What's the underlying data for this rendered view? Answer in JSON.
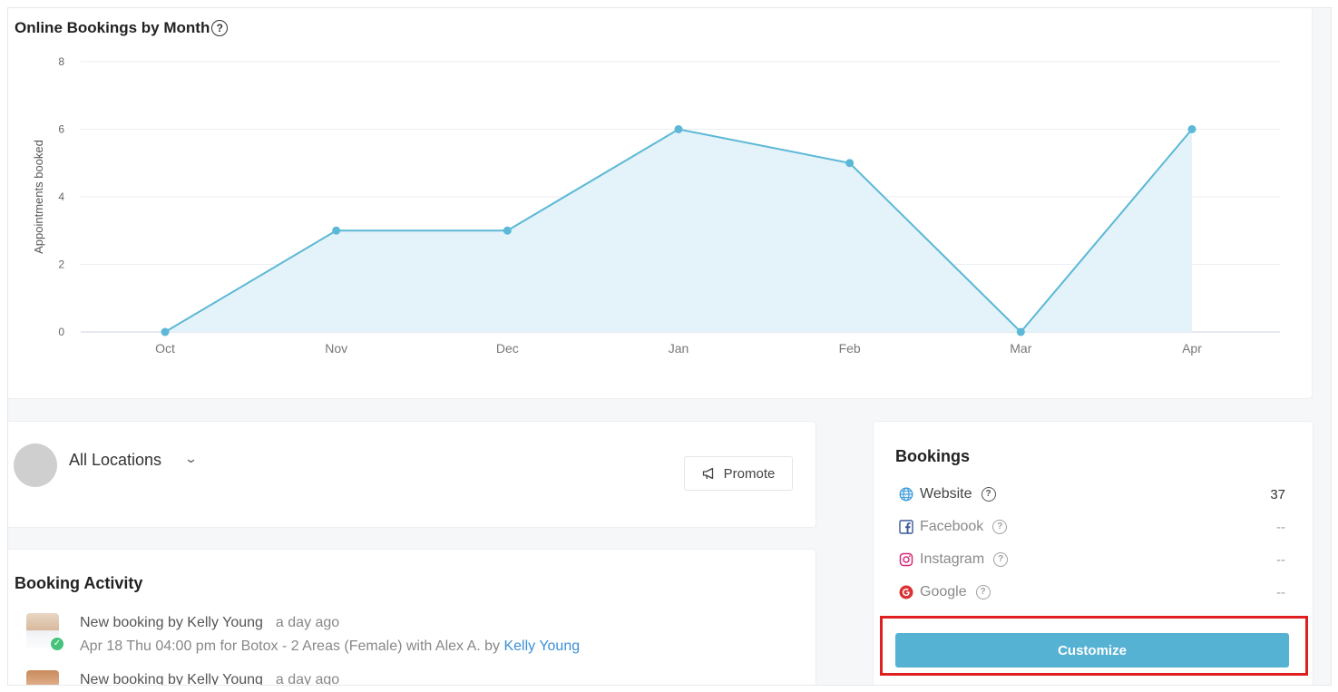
{
  "chart": {
    "title": "Online Bookings by Month",
    "help_icon": "question-circle-icon"
  },
  "chart_data": {
    "type": "area",
    "title": "Online Bookings by Month",
    "xlabel": "",
    "ylabel": "Appointments booked",
    "categories": [
      "Oct",
      "Nov",
      "Dec",
      "Jan",
      "Feb",
      "Mar",
      "Apr"
    ],
    "values": [
      0,
      3,
      3,
      6,
      5,
      0,
      6
    ],
    "ylim": [
      0,
      8
    ],
    "yticks": [
      0,
      2,
      4,
      6,
      8
    ],
    "grid": true,
    "line_color": "#5bb8d6",
    "fill_color": "#e4f2f9"
  },
  "location": {
    "label": "All Locations",
    "chevron_icon": "chevron-down-icon",
    "promote_label": "Promote",
    "promote_icon": "megaphone-icon"
  },
  "activity": {
    "title": "Booking Activity",
    "items": [
      {
        "line1": "New booking by Kelly Young",
        "time": "a day ago",
        "line2": "Apr 18 Thu 04:00 pm for Botox - 2 Areas (Female) with Alex A. by ",
        "link": "Kelly Young"
      },
      {
        "line1": "New booking by Kelly Young",
        "time": "a day ago"
      }
    ]
  },
  "bookings": {
    "title": "Bookings",
    "sources": [
      {
        "label": "Website",
        "value": "37",
        "icon": "globe-icon",
        "color": "#3a9ad9"
      },
      {
        "label": "Facebook",
        "value": "--",
        "icon": "facebook-icon",
        "color": "#3b5998"
      },
      {
        "label": "Instagram",
        "value": "--",
        "icon": "instagram-icon",
        "color": "#d62976"
      },
      {
        "label": "Google",
        "value": "--",
        "icon": "google-icon",
        "color": "#db3236"
      }
    ],
    "customize_label": "Customize"
  }
}
